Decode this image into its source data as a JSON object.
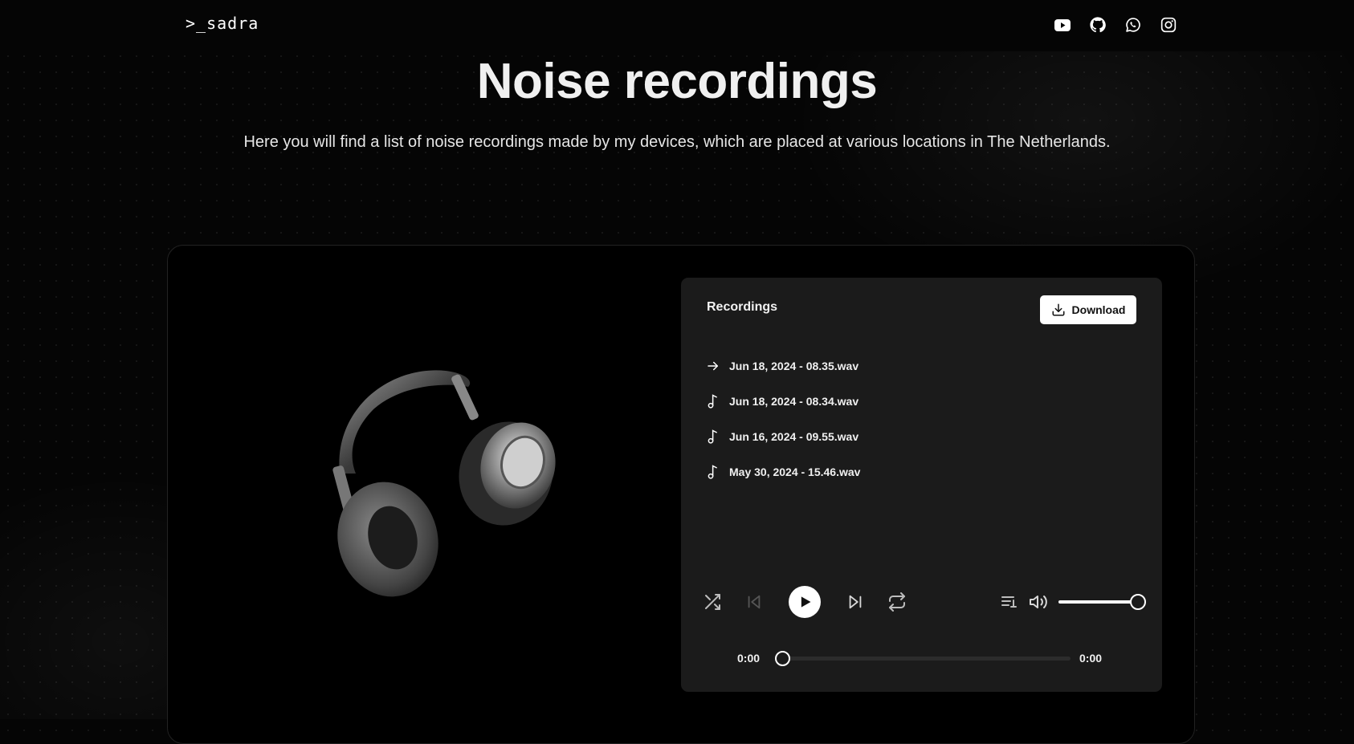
{
  "header": {
    "logo": ">_sadra",
    "socials": [
      {
        "icon": "youtube-icon"
      },
      {
        "icon": "github-icon"
      },
      {
        "icon": "whatsapp-icon"
      },
      {
        "icon": "instagram-icon"
      }
    ]
  },
  "hero": {
    "title": "Noise recordings",
    "subtitle": "Here you will find a list of noise recordings made by my devices, which are placed at various locations in The Netherlands."
  },
  "player": {
    "title": "Recordings",
    "download_label": "Download",
    "tracks": [
      {
        "name": "Jun 18, 2024 - 08.35.wav",
        "icon": "arrow-right-icon"
      },
      {
        "name": "Jun 18, 2024 - 08.34.wav",
        "icon": "music-note-icon"
      },
      {
        "name": "Jun 16, 2024 - 09.55.wav",
        "icon": "music-note-icon"
      },
      {
        "name": "May 30, 2024 - 15.46.wav",
        "icon": "music-note-icon"
      }
    ],
    "current_time": "0:00",
    "duration": "0:00",
    "progress": 0,
    "volume": 1.0
  },
  "colors": {
    "background": "#050505",
    "card": "#1b1b1b",
    "accent": "#ffffff"
  }
}
